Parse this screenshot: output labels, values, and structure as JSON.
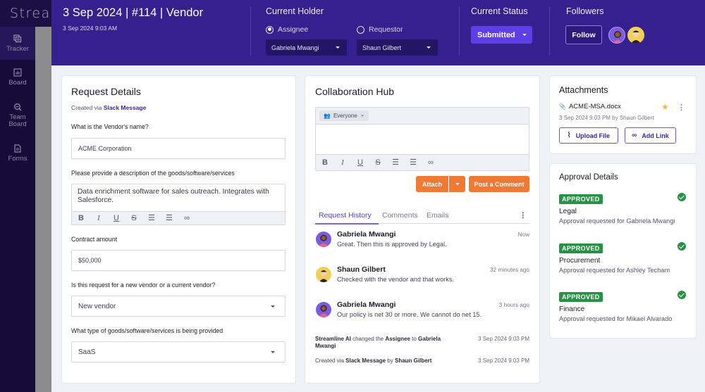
{
  "brand": {
    "name": "Streamline"
  },
  "sidebar": {
    "items": [
      {
        "label": "Tracker",
        "icon": "tracker-icon",
        "active": true
      },
      {
        "label": "Board",
        "icon": "board-icon",
        "active": false
      },
      {
        "label": "Team Board",
        "icon": "team-board-icon",
        "active": false
      },
      {
        "label": "Forms",
        "icon": "forms-icon",
        "active": false
      }
    ]
  },
  "header": {
    "title": "3 Sep 2024 | #114 | Vendor",
    "subtitle": "3 Sep 2024 9:03 AM",
    "current_holder": {
      "label": "Current Holder",
      "options": [
        {
          "label": "Assignee",
          "selected": true,
          "value": "Gabriela Mwangi"
        },
        {
          "label": "Requestor",
          "selected": false,
          "value": "Shaun Gilbert"
        }
      ]
    },
    "current_status": {
      "label": "Current Status",
      "value": "Submitted"
    },
    "followers": {
      "label": "Followers",
      "follow_label": "Follow",
      "avatars": [
        "Gabriela Mwangi",
        "Shaun Gilbert"
      ]
    }
  },
  "request_details": {
    "title": "Request Details",
    "created_via_prefix": "Created via",
    "created_via_link": "Slack Message",
    "fields": [
      {
        "label": "What is the Vendor's name?",
        "value": "ACME Corporation",
        "type": "text"
      },
      {
        "label": "Please provide a description of the goods/software/services",
        "value": "Data enrichment software for sales outreach. Integrates with Salesforce.",
        "type": "richtext"
      },
      {
        "label": "Contract amount",
        "value": "$50,000",
        "type": "text"
      },
      {
        "label": "Is this request for a new vendor or a current vendor?",
        "value": "New vendor",
        "type": "select"
      },
      {
        "label": "What type of goods/software/services is being provided",
        "value": "SaaS",
        "type": "select"
      }
    ]
  },
  "collab_hub": {
    "title": "Collaboration Hub",
    "audience": "Everyone",
    "comment_value": "",
    "attach_label": "Attach",
    "post_label": "Post a Comment",
    "tabs": [
      {
        "label": "Request History",
        "active": true
      },
      {
        "label": "Comments",
        "active": false
      },
      {
        "label": "Emails",
        "active": false
      }
    ],
    "comments": [
      {
        "name": "Gabriela Mwangi",
        "text": "Great. Then this is approved by Legal.",
        "time": "Now"
      },
      {
        "name": "Shaun Gilbert",
        "text": "Checked with the vendor and that works.",
        "time": "32 minutes ago"
      },
      {
        "name": "Gabriela Mwangi",
        "text": "Our policy is net 30 or more. We cannot do net 15.",
        "time": "3 hours ago"
      }
    ],
    "events": [
      {
        "actor": "Streamline AI",
        "middle": " changed the ",
        "field": "Assignee",
        "to": " to ",
        "target": "Gabriela Mwangi",
        "time": "3 Sep 2024 9:03 PM"
      },
      {
        "prefix": "Created via ",
        "source": "Slack Message",
        "by": " by ",
        "actor": "Shaun Gilbert",
        "time": "3 Sep 2024 9:03 PM"
      }
    ]
  },
  "attachments": {
    "title": "Attachments",
    "files": [
      {
        "name": "ACME-MSA.docx",
        "meta": "3 Sep 2024 9:03 PM by Shaun Gilbert",
        "starred": true
      }
    ],
    "upload_label": "Upload File",
    "add_link_label": "Add Link"
  },
  "approvals": {
    "title": "Approval Details",
    "items": [
      {
        "status": "APPROVED",
        "name": "Legal",
        "desc": "Approval requested for Gabriela Mwangi"
      },
      {
        "status": "APPROVED",
        "name": "Procurement",
        "desc": "Approval requested for Ashley Techam"
      },
      {
        "status": "APPROVED",
        "name": "Finance",
        "desc": "Approval requested for Mikael Alvarado"
      }
    ]
  },
  "colors": {
    "header_bg": "#35208f",
    "sidebar_bg": "#150c3a",
    "accent": "#5e3ee6",
    "orange": "#f07a34",
    "approved_green": "#279246",
    "star": "#f5b82e"
  }
}
